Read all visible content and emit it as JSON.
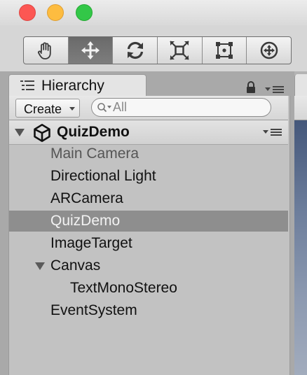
{
  "window": {
    "traffic_lights": {
      "close": "#fc5753",
      "minimize": "#fdbc40",
      "zoom": "#33c748"
    }
  },
  "toolbar": {
    "tools": [
      {
        "icon": "hand-icon",
        "active": false
      },
      {
        "icon": "move-icon",
        "active": true
      },
      {
        "icon": "rotate-icon",
        "active": false
      },
      {
        "icon": "scale-icon",
        "active": false
      },
      {
        "icon": "rect-icon",
        "active": false
      },
      {
        "icon": "transform-icon",
        "active": false
      }
    ]
  },
  "hierarchy": {
    "tab_label": "Hierarchy",
    "create_label": "Create",
    "search_placeholder": "All",
    "scene_name": "QuizDemo",
    "items": [
      {
        "label": "Main Camera",
        "indent": 1,
        "muted": true
      },
      {
        "label": "Directional Light",
        "indent": 1
      },
      {
        "label": "ARCamera",
        "indent": 1
      },
      {
        "label": "QuizDemo",
        "indent": 1,
        "selected": true
      },
      {
        "label": "ImageTarget",
        "indent": 1
      },
      {
        "label": "Canvas",
        "indent": 1,
        "expanded": true
      },
      {
        "label": "TextMonoStereo",
        "indent": 2
      },
      {
        "label": "EventSystem",
        "indent": 1
      }
    ]
  }
}
